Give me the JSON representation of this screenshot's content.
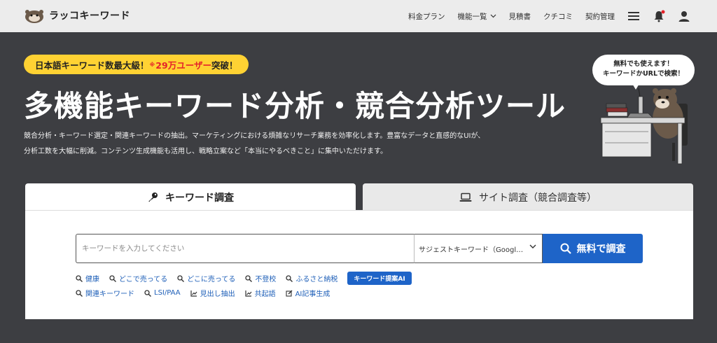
{
  "header": {
    "logo_text": "ラッコキーワード",
    "nav": [
      {
        "label": "料金プラン"
      },
      {
        "label": "機能一覧"
      },
      {
        "label": "見積書"
      },
      {
        "label": "クチコミ"
      },
      {
        "label": "契約管理"
      }
    ]
  },
  "hero": {
    "badge_pre": "日本語キーワード数最大級！",
    "badge_mark": "※",
    "badge_count": "29万ユーザー",
    "badge_post": "突破！",
    "title": "多機能キーワード分析・競合分析ツール",
    "desc_line1": "競合分析・キーワード選定・関連キーワードの抽出。マーケティングにおける煩雑なリサーチ業務を効率化します。豊富なデータと直感的なUIが、",
    "desc_line2": "分析工数を大幅に削減。コンテンツ生成機能も活用し、戦略立案など「本当にやるべきこと」に集中いただけます。",
    "bubble_line1": "無料でも使えます！",
    "bubble_line2": "キーワードかURLで検索！"
  },
  "tabs": {
    "keyword": "キーワード調査",
    "site": "サイト調査（競合調査等）"
  },
  "search": {
    "placeholder": "キーワードを入力してください",
    "select_value": "サジェストキーワード（Googl…",
    "button_label": "無料で調査"
  },
  "quick_links_row1": [
    {
      "label": "健康"
    },
    {
      "label": "どこで売ってる"
    },
    {
      "label": "どこに売ってる"
    },
    {
      "label": "不登校"
    },
    {
      "label": "ふるさと納税"
    }
  ],
  "ai_pill": "キーワード提案AI",
  "quick_links_row2": [
    {
      "label": "関連キーワード",
      "icon": "search-icon"
    },
    {
      "label": "LSI/PAA",
      "icon": "search-icon"
    },
    {
      "label": "見出し抽出",
      "icon": "chart-icon"
    },
    {
      "label": "共起語",
      "icon": "chart-icon"
    },
    {
      "label": "AI記事生成",
      "icon": "edit-icon"
    }
  ],
  "colors": {
    "hero_bg": "#3d3e42",
    "header_bg": "#ececec",
    "accent": "#1e64c8",
    "badge": "#ffd233",
    "badge_red": "#e4222a"
  }
}
